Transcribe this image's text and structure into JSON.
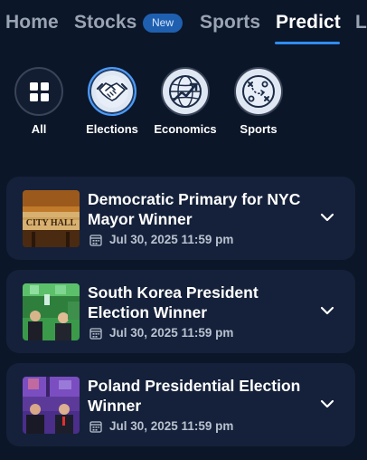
{
  "nav": {
    "items": [
      {
        "label": "Home"
      },
      {
        "label": "Stocks",
        "badge": "New"
      },
      {
        "label": "Sports"
      },
      {
        "label": "Predict",
        "active": true
      },
      {
        "label": "L"
      }
    ]
  },
  "categories": [
    {
      "label": "All",
      "icon": "grid-icon"
    },
    {
      "label": "Elections",
      "icon": "handshake-icon",
      "selected": true
    },
    {
      "label": "Economics",
      "icon": "globe-chart-icon"
    },
    {
      "label": "Sports",
      "icon": "playbook-icon"
    }
  ],
  "markets": [
    {
      "title": "Democratic Primary for NYC Mayor Winner",
      "date": "Jul 30, 2025 11:59 pm",
      "thumb_text": "CITY HALL"
    },
    {
      "title": "South Korea President Election Winner",
      "date": "Jul 30, 2025 11:59 pm"
    },
    {
      "title": "Poland Presidential Election Winner",
      "date": "Jul 30, 2025 11:59 pm"
    }
  ],
  "colors": {
    "background": "#0b1628",
    "card": "#15213a",
    "accent": "#2f8cf0",
    "badge": "#1f5fb0"
  }
}
